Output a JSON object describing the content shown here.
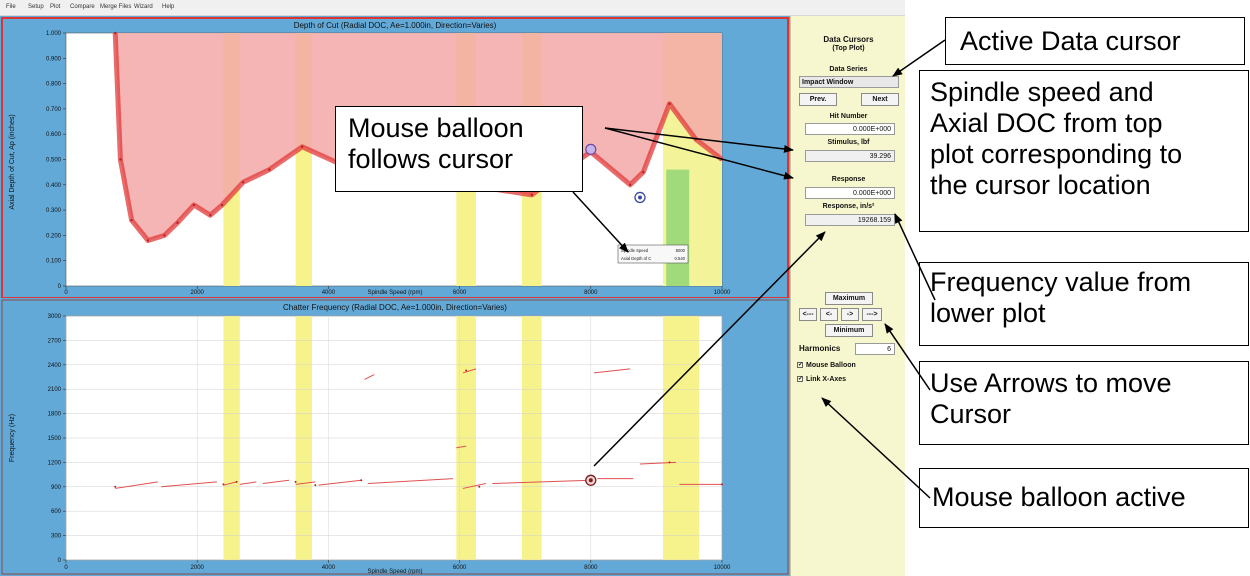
{
  "menu": [
    "File",
    "Setup",
    "Plot",
    "Compare",
    "Merge Files",
    "Wizard",
    "Help"
  ],
  "top_plot": {
    "title": "Depth of Cut (Radial DOC, Ae=1.000in, Direction=Varies)",
    "xlabel": "Spindle Speed (rpm)",
    "ylabel": "Axial Depth of Cut, Ap (inches)",
    "yticks": [
      "1.000",
      "0.900",
      "0.800",
      "0.700",
      "0.600",
      "0.500",
      "0.400",
      "0.300",
      "0.200",
      "0.100",
      "0"
    ],
    "xticks": [
      "0",
      "2000",
      "4000",
      "6000",
      "8000",
      "10000"
    ],
    "balloon": {
      "l1": "Spindle Speed",
      "v1": "8000",
      "l2": "Axial Depth of C",
      "v2": "0.540"
    }
  },
  "bottom_plot": {
    "title": "Chatter Frequency (Radial DOC, Ae=1.000in, Direction=Varies)",
    "xlabel": "Spindle Speed (rpm)",
    "ylabel": "Frequency (Hz)",
    "yticks": [
      "3000",
      "2700",
      "2400",
      "2100",
      "1800",
      "1500",
      "1200",
      "900",
      "600",
      "300",
      "0"
    ],
    "xticks": [
      "0",
      "2000",
      "4000",
      "6000",
      "8000",
      "10000"
    ]
  },
  "chart_data": [
    {
      "type": "area",
      "title": "Depth of Cut (Radial DOC, Ae=1.000in, Direction=Varies)",
      "xlabel": "Spindle Speed (rpm)",
      "ylabel": "Axial Depth of Cut, Ap (inches)",
      "xlim": [
        0,
        10000
      ],
      "ylim": [
        0,
        1.0
      ],
      "series": [
        {
          "x": [
            750,
            830,
            1000,
            1250,
            1500,
            1700,
            1950,
            2200,
            2380,
            2700,
            3100,
            3600,
            4200,
            4900,
            5600,
            6300,
            6600,
            7100,
            7600,
            8000,
            8600,
            8800,
            9200,
            9600,
            10000
          ],
          "y": [
            1.0,
            0.5,
            0.26,
            0.18,
            0.2,
            0.25,
            0.32,
            0.28,
            0.32,
            0.41,
            0.46,
            0.55,
            0.48,
            0.52,
            0.45,
            0.42,
            0.38,
            0.36,
            0.46,
            0.53,
            0.4,
            0.45,
            0.72,
            0.58,
            0.5
          ]
        }
      ],
      "cursor": {
        "x": 8000,
        "y": 0.54
      },
      "grid": false
    },
    {
      "type": "scatter",
      "title": "Chatter Frequency (Radial DOC, Ae=1.000in, Direction=Varies)",
      "xlabel": "Spindle Speed (rpm)",
      "ylabel": "Frequency (Hz)",
      "xlim": [
        0,
        10000
      ],
      "ylim": [
        0,
        3000
      ],
      "series": [
        {
          "x": [
            750,
            2400,
            2600,
            3500,
            3800,
            4500,
            6100,
            6300,
            8000,
            9200,
            10000
          ],
          "y": [
            900,
            930,
            960,
            960,
            920,
            980,
            2330,
            900,
            980,
            1200,
            930
          ]
        }
      ],
      "cursor": {
        "x": 8000,
        "y": 980
      },
      "grid": true
    }
  ],
  "panel": {
    "title1": "Data Cursors",
    "title2": "(Top Plot)",
    "series_label": "Data Series",
    "series_value": "Impact Window",
    "prev": "Prev.",
    "next": "Next",
    "hit_label": "Hit Number",
    "hit_value": "0.000E+000",
    "stim_label": "Stimulus, lbf",
    "stim_value": "39.296",
    "resp_label": "Response",
    "resp_value": "0.000E+000",
    "resp_g_label": "Response, in/s²",
    "resp_g_value": "19268.159",
    "maximum": "Maximum",
    "minimum": "Minimum",
    "arrows": [
      "<---",
      "<-",
      "->",
      "--->"
    ],
    "harmonics_label": "Harmonics",
    "harmonics_value": "6",
    "mouse_balloon": "Mouse Balloon",
    "link_axes": "Link X-Axes"
  },
  "callouts": {
    "active": "Active Data cursor",
    "spindle": "Spindle speed and Axial DOC from top plot corresponding to the cursor location",
    "spindle_lines": [
      "Spindle speed and",
      "Axial DOC from top",
      "plot corresponding to",
      "the cursor location"
    ],
    "freq_lines": [
      "Frequency value from",
      "lower plot"
    ],
    "arrows_lines": [
      "Use Arrows to move",
      "Cursor"
    ],
    "balloon": "Mouse balloon active",
    "mouse_lines": [
      "Mouse balloon",
      "follows cursor"
    ]
  },
  "colors": {
    "plot_bg": "#63a9d8",
    "stable_fill": "#f3a8a8",
    "lobe_edge": "#e23b3b",
    "yellow_band": "#f7f38c",
    "panel_bg": "#f6f6cf"
  }
}
